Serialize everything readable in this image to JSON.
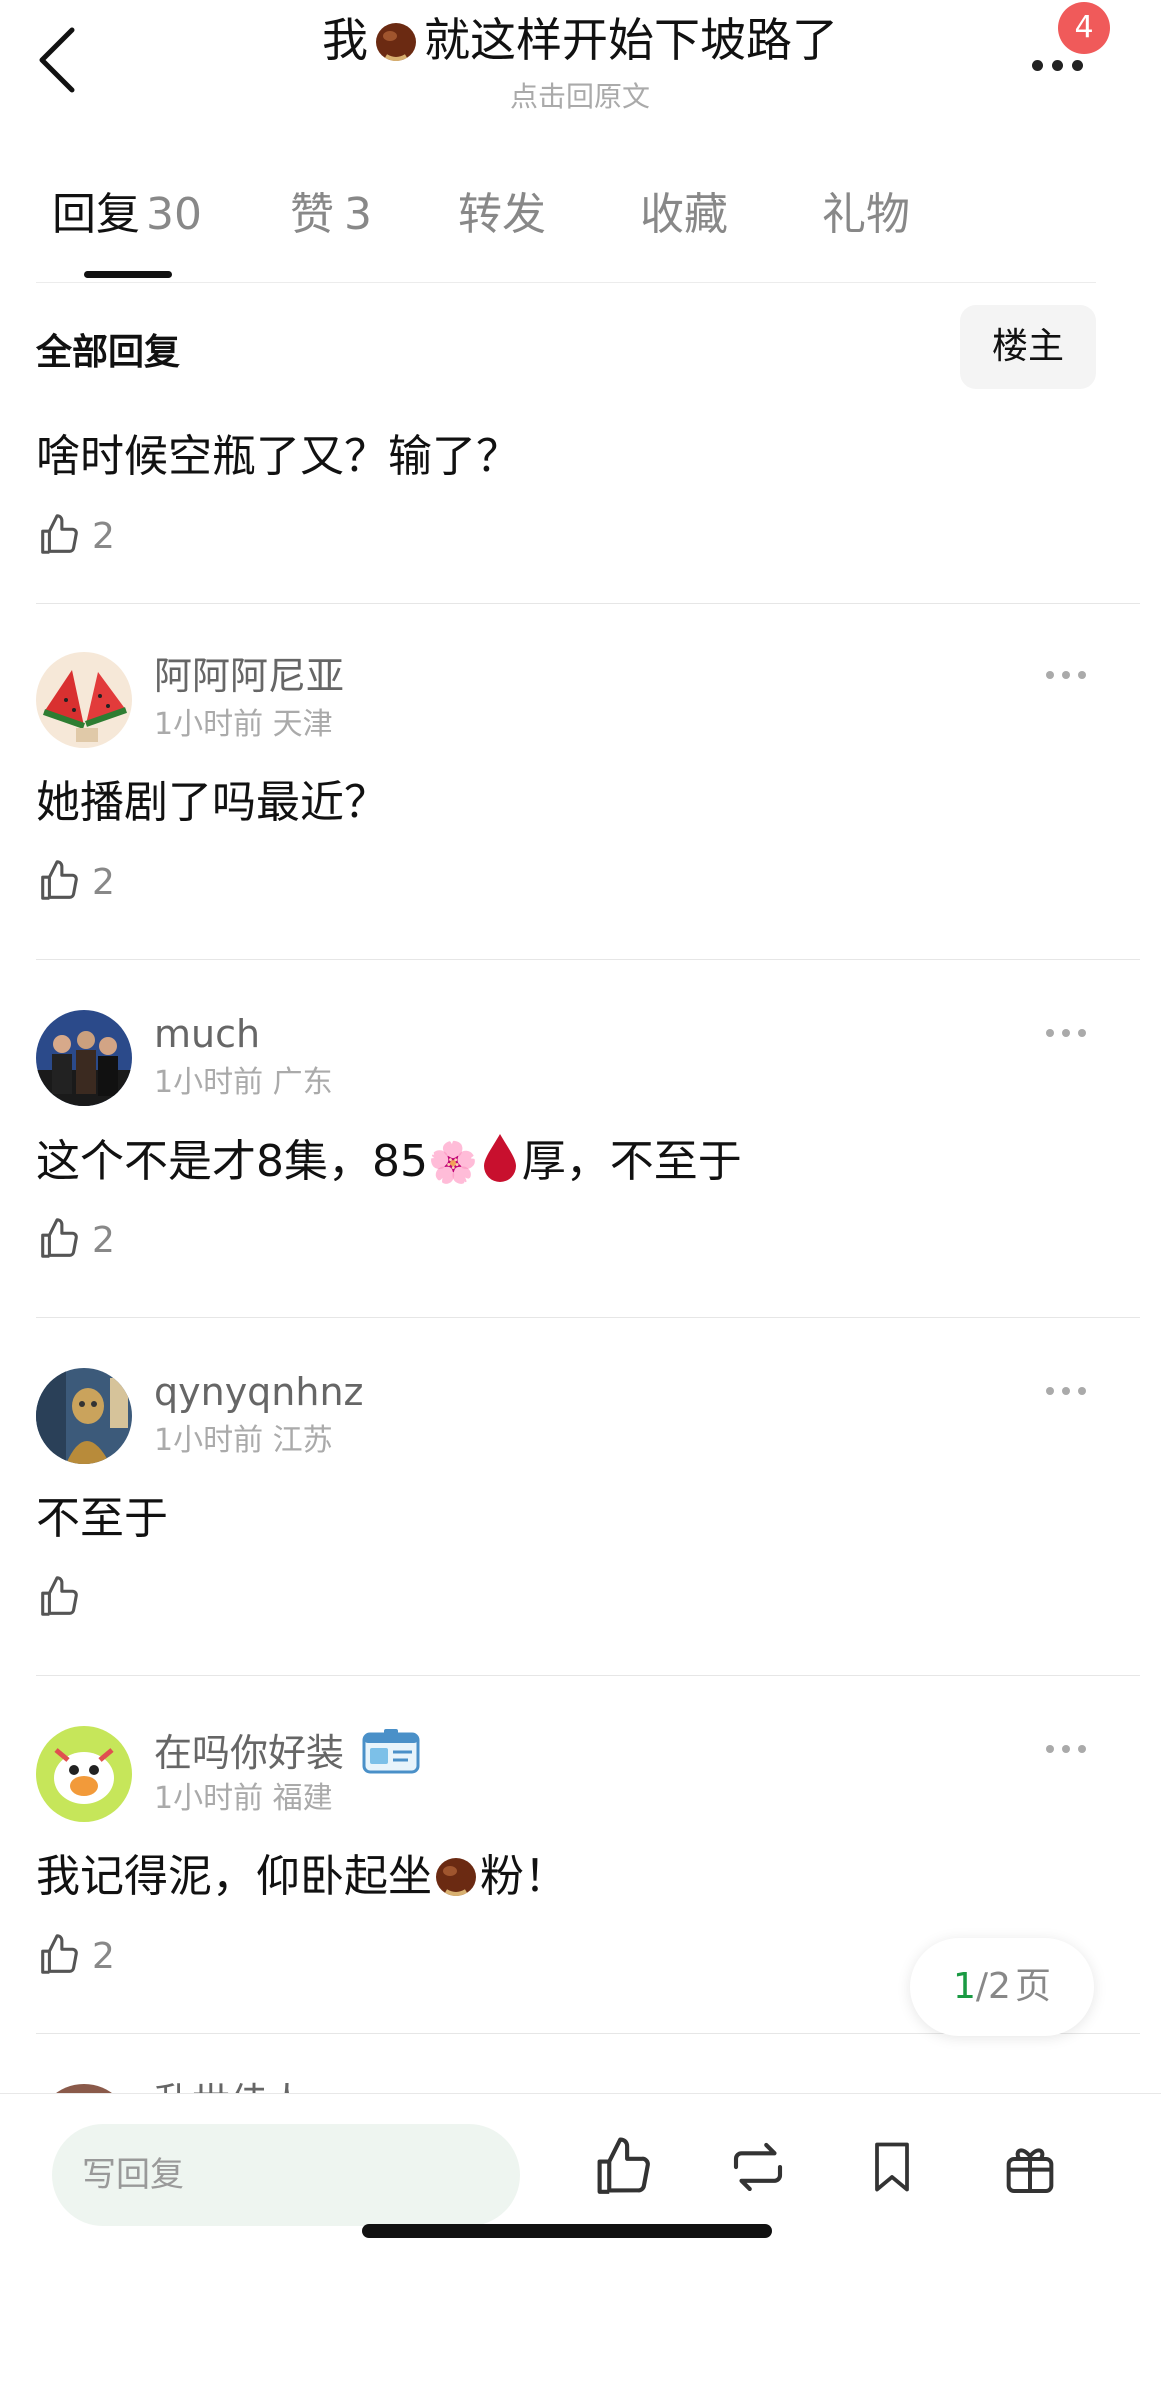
{
  "header": {
    "title_prefix": "我",
    "title_suffix": "就这样开始下坡路了",
    "subtitle": "点击回原文",
    "notification_count": "4"
  },
  "tabs": [
    {
      "label": "回复",
      "count": "30"
    },
    {
      "label": "赞",
      "count": "3"
    },
    {
      "label": "转发",
      "count": ""
    },
    {
      "label": "收藏",
      "count": ""
    },
    {
      "label": "礼物",
      "count": ""
    }
  ],
  "filter": {
    "label": "全部回复",
    "owner_button": "楼主"
  },
  "comments": [
    {
      "text": "啥时候空瓶了又？输了？",
      "likes": "2"
    },
    {
      "username": "阿阿阿尼亚",
      "time": "1小时前",
      "location": "天津",
      "text": "她播剧了吗最近？",
      "likes": "2"
    },
    {
      "username": "much",
      "time": "1小时前",
      "location": "广东",
      "text_before": "这个不是才8集，85",
      "flower_emoji": "🌸",
      "drop_emoji": "🩸",
      "text_after": "厚，不至于",
      "likes": "2"
    },
    {
      "username": "qynyqnhnz",
      "time": "1小时前",
      "location": "江苏",
      "text": "不至于",
      "likes": ""
    },
    {
      "username": "在吗你好装",
      "time": "1小时前",
      "location": "福建",
      "text_before": "我记得泥，仰卧起坐",
      "text_after": "粉！",
      "likes": "2"
    },
    {
      "username": "乱世佳人"
    }
  ],
  "pagination": {
    "current": "1",
    "total": "/2",
    "unit": "页"
  },
  "bottom_bar": {
    "reply_placeholder": "写回复"
  },
  "colors": {
    "accent_green": "#1a9a43",
    "badge_red": "#f05a5a",
    "input_bg": "#eef5f0"
  },
  "icons": [
    "back-icon",
    "more-icon",
    "thumbs-up-icon",
    "repost-icon",
    "bookmark-icon",
    "gift-icon"
  ]
}
